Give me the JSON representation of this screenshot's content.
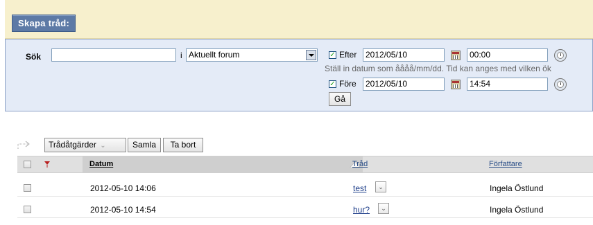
{
  "header": {
    "create_thread_label": "Skapa tråd:"
  },
  "search": {
    "label": "Sök",
    "query_value": "",
    "in_label": "i",
    "scope_selected": "Aktuellt forum",
    "after": {
      "checked": true,
      "label": "Efter",
      "date": "2012/05/10",
      "time": "00:00"
    },
    "hint": "Ställ in datum som åååå/mm/dd. Tid kan anges med vilken ök",
    "before": {
      "checked": true,
      "label": "Före",
      "date": "2012/05/10",
      "time": "14:54"
    },
    "go_label": "Gå"
  },
  "toolbar": {
    "thread_actions_label": "Trådåtgärder",
    "collect_label": "Samla",
    "delete_label": "Ta bort"
  },
  "table": {
    "headers": {
      "date": "Datum",
      "thread": "Tråd",
      "author": "Författare"
    },
    "rows": [
      {
        "date": "2012-05-10 14:06",
        "thread": "test",
        "author": "Ingela Östlund"
      },
      {
        "date": "2012-05-10 14:54",
        "thread": "hur?",
        "author": "Ingela Östlund"
      }
    ]
  },
  "colors": {
    "create_button_bg": "#5d7aa6",
    "top_bar_bg": "#f7f0cd",
    "search_panel_bg": "#e4ebf7",
    "link_blue": "#1f3f8a",
    "flag_red": "#b82020"
  }
}
